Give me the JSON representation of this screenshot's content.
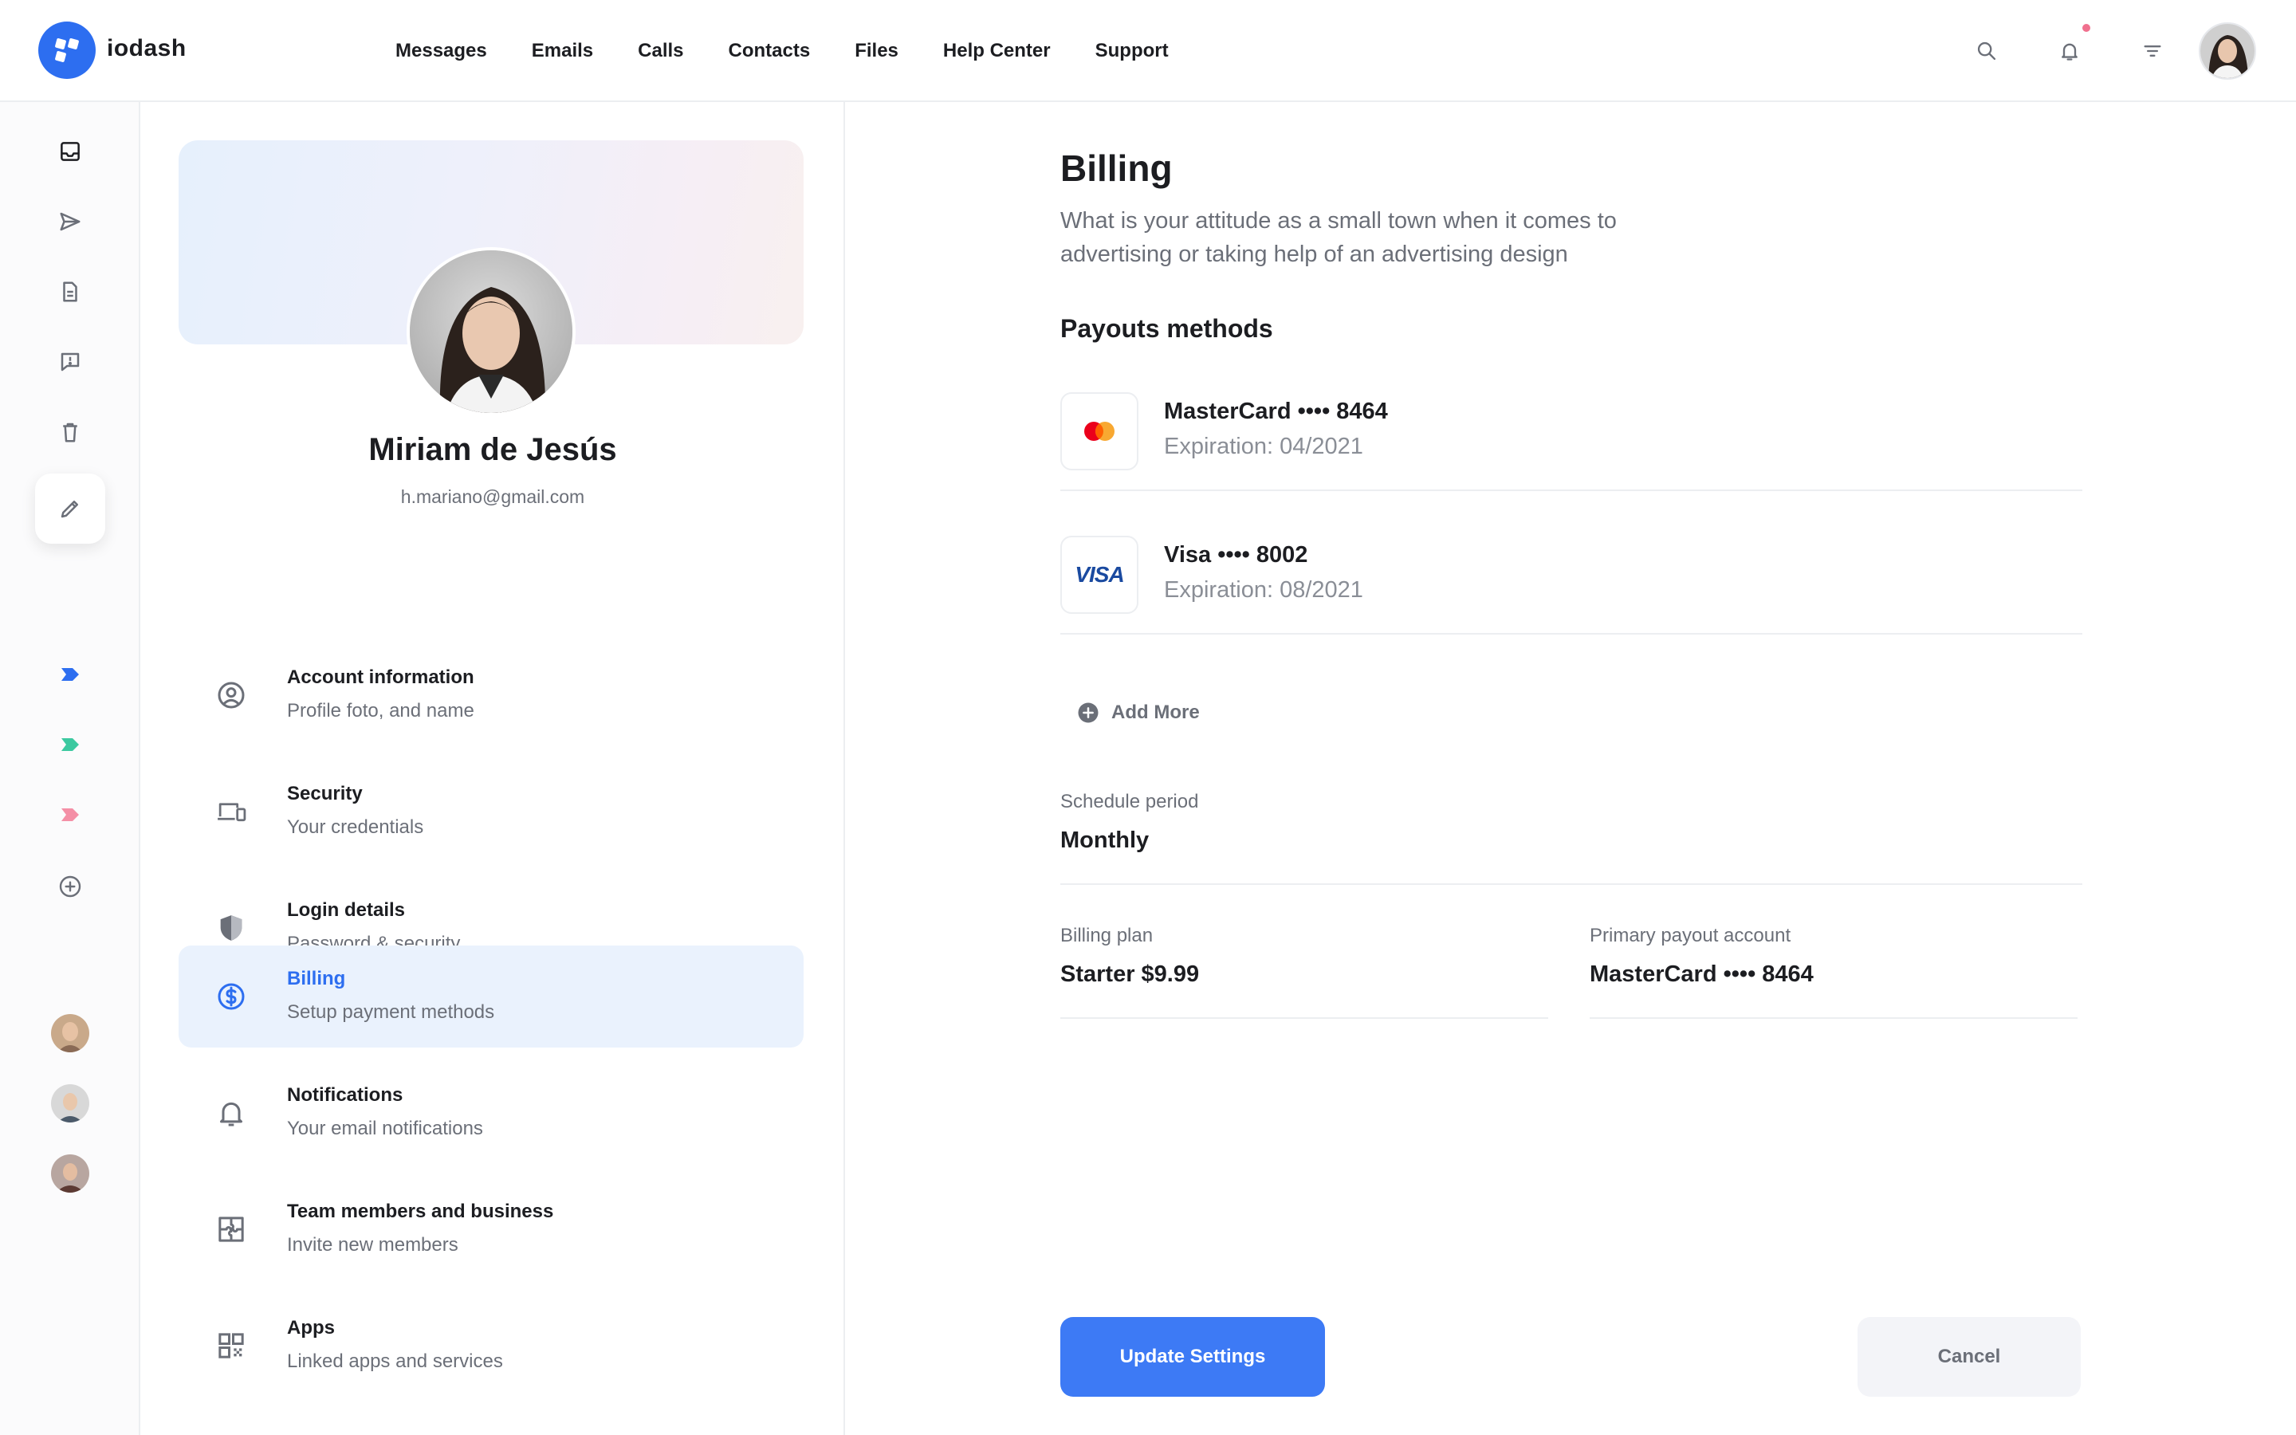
{
  "app": {
    "brand": "iodash",
    "brand_color": "#2d6ef0"
  },
  "nav": {
    "items": [
      "Messages",
      "Emails",
      "Calls",
      "Contacts",
      "Files",
      "Help Center",
      "Support"
    ]
  },
  "topbar": {
    "icons": [
      "search-icon",
      "bell-icon",
      "filter-icon"
    ],
    "notification_dot_color": "#f0708e"
  },
  "rail": {
    "icons": [
      "inbox-icon",
      "send-icon",
      "document-icon",
      "feedback-icon",
      "trash-icon",
      "pencil-icon"
    ],
    "tags": [
      {
        "color": "#2d6ef0"
      },
      {
        "color": "#3cc9a0"
      },
      {
        "color": "#f48fa6"
      }
    ]
  },
  "profile": {
    "name": "Miriam de Jesús",
    "email": "h.mariano@gmail.com"
  },
  "menu": {
    "items": [
      {
        "title": "Account information",
        "subtitle": "Profile foto, and name",
        "icon": "user-circle-icon"
      },
      {
        "title": "Security",
        "subtitle": "Your credentials",
        "icon": "devices-icon"
      },
      {
        "title": "Login details",
        "subtitle": "Password & security",
        "icon": "shield-icon"
      },
      {
        "title": "Billing",
        "subtitle": "Setup payment methods",
        "icon": "dollar-circle-icon"
      },
      {
        "title": "Notifications",
        "subtitle": "Your email notifications",
        "icon": "bell-icon"
      },
      {
        "title": "Team members and business",
        "subtitle": "Invite new members",
        "icon": "puzzle-icon"
      },
      {
        "title": "Apps",
        "subtitle": "Linked apps and services",
        "icon": "apps-grid-icon"
      }
    ],
    "active": "Billing"
  },
  "billing": {
    "title": "Billing",
    "description": "What is your attitude as a small town when it comes to advertising or taking help of an advertising design",
    "payouts_title": "Payouts methods",
    "methods": [
      {
        "name": "MasterCard •••• 8464",
        "expiration": "Expiration: 04/2021",
        "logo": "mastercard-logo"
      },
      {
        "name": "Visa •••• 8002",
        "expiration": "Expiration: 08/2021",
        "logo": "visa-logo",
        "logo_text": "VISA"
      }
    ],
    "add_more": "Add More",
    "schedule_label": "Schedule period",
    "schedule_value": "Monthly",
    "plan_label": "Billing plan",
    "plan_value": "Starter $9.99",
    "payout_account_label": "Primary payout account",
    "payout_account_value": "MasterCard •••• 8464",
    "update_button": "Update Settings",
    "cancel_button": "Cancel"
  }
}
